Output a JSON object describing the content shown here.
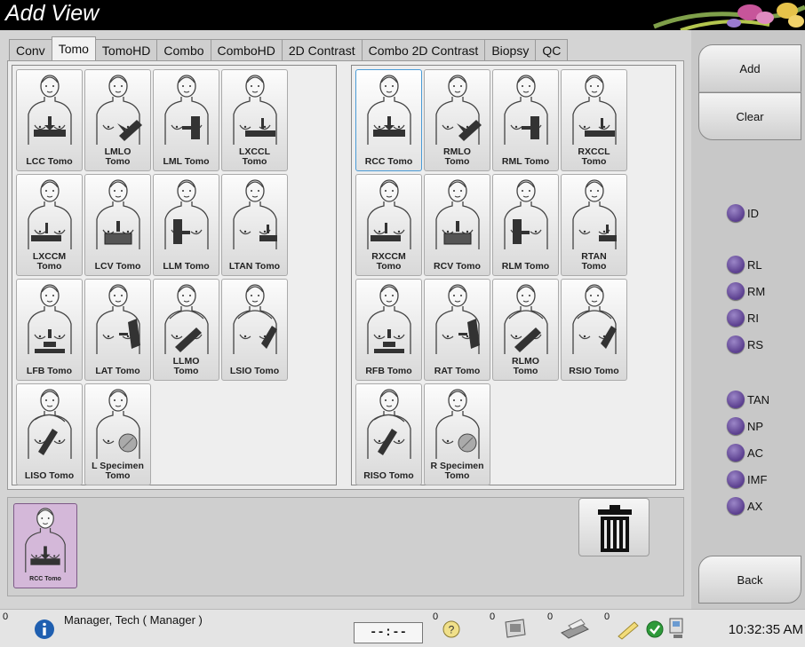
{
  "title": "Add View",
  "tabs": [
    "Conv",
    "Tomo",
    "TomoHD",
    "Combo",
    "ComboHD",
    "2D Contrast",
    "Combo 2D Contrast",
    "Biopsy",
    "QC"
  ],
  "active_tab": "Tomo",
  "left_views": [
    {
      "label": "LCC Tomo",
      "icon": "lcc-tomo-icon"
    },
    {
      "label": "LMLO\nTomo",
      "icon": "lmlo-tomo-icon"
    },
    {
      "label": "LML Tomo",
      "icon": "lml-tomo-icon"
    },
    {
      "label": "LXCCL\nTomo",
      "icon": "lxccl-tomo-icon"
    },
    {
      "label": "LXCCM\nTomo",
      "icon": "lxccm-tomo-icon"
    },
    {
      "label": "LCV Tomo",
      "icon": "lcv-tomo-icon"
    },
    {
      "label": "LLM Tomo",
      "icon": "llm-tomo-icon"
    },
    {
      "label": "LTAN Tomo",
      "icon": "ltan-tomo-icon"
    },
    {
      "label": "LFB Tomo",
      "icon": "lfb-tomo-icon"
    },
    {
      "label": "LAT Tomo",
      "icon": "lat-tomo-icon"
    },
    {
      "label": "LLMO\nTomo",
      "icon": "llmo-tomo-icon"
    },
    {
      "label": "LSIO Tomo",
      "icon": "lsio-tomo-icon"
    },
    {
      "label": "LISO Tomo",
      "icon": "liso-tomo-icon"
    },
    {
      "label": "L Specimen\nTomo",
      "icon": "l-specimen-tomo-icon"
    }
  ],
  "right_views": [
    {
      "label": "RCC Tomo",
      "icon": "rcc-tomo-icon"
    },
    {
      "label": "RMLO\nTomo",
      "icon": "rmlo-tomo-icon"
    },
    {
      "label": "RML Tomo",
      "icon": "rml-tomo-icon"
    },
    {
      "label": "RXCCL\nTomo",
      "icon": "rxccl-tomo-icon"
    },
    {
      "label": "RXCCM\nTomo",
      "icon": "rxccm-tomo-icon"
    },
    {
      "label": "RCV Tomo",
      "icon": "rcv-tomo-icon"
    },
    {
      "label": "RLM Tomo",
      "icon": "rlm-tomo-icon"
    },
    {
      "label": "RTAN\nTomo",
      "icon": "rtan-tomo-icon"
    },
    {
      "label": "RFB Tomo",
      "icon": "rfb-tomo-icon"
    },
    {
      "label": "RAT Tomo",
      "icon": "rat-tomo-icon"
    },
    {
      "label": "RLMO\nTomo",
      "icon": "rlmo-tomo-icon"
    },
    {
      "label": "RSIO Tomo",
      "icon": "rsio-tomo-icon"
    },
    {
      "label": "RISO Tomo",
      "icon": "riso-tomo-icon"
    },
    {
      "label": "R Specimen\nTomo",
      "icon": "r-specimen-tomo-icon"
    }
  ],
  "selected_view_highlight": "RCC Tomo",
  "added_view": {
    "label": "RCC Tomo",
    "icon": "rcc-tomo-icon"
  },
  "sidebar": {
    "add": "Add",
    "clear": "Clear",
    "back": "Back",
    "modifiers": [
      "ID",
      "RL",
      "RM",
      "RI",
      "RS",
      "TAN",
      "NP",
      "AC",
      "IMF",
      "AX"
    ]
  },
  "status": {
    "user": "Manager, Tech ( Manager )",
    "time_field": "--:--",
    "counts": [
      "0",
      "0",
      "0",
      "0",
      "0"
    ],
    "clock": "10:32:35 AM"
  },
  "colors": {
    "modifier": "#6a4e9e",
    "selected_thumb": "#d4b8d9",
    "title_bg": "#000000"
  }
}
